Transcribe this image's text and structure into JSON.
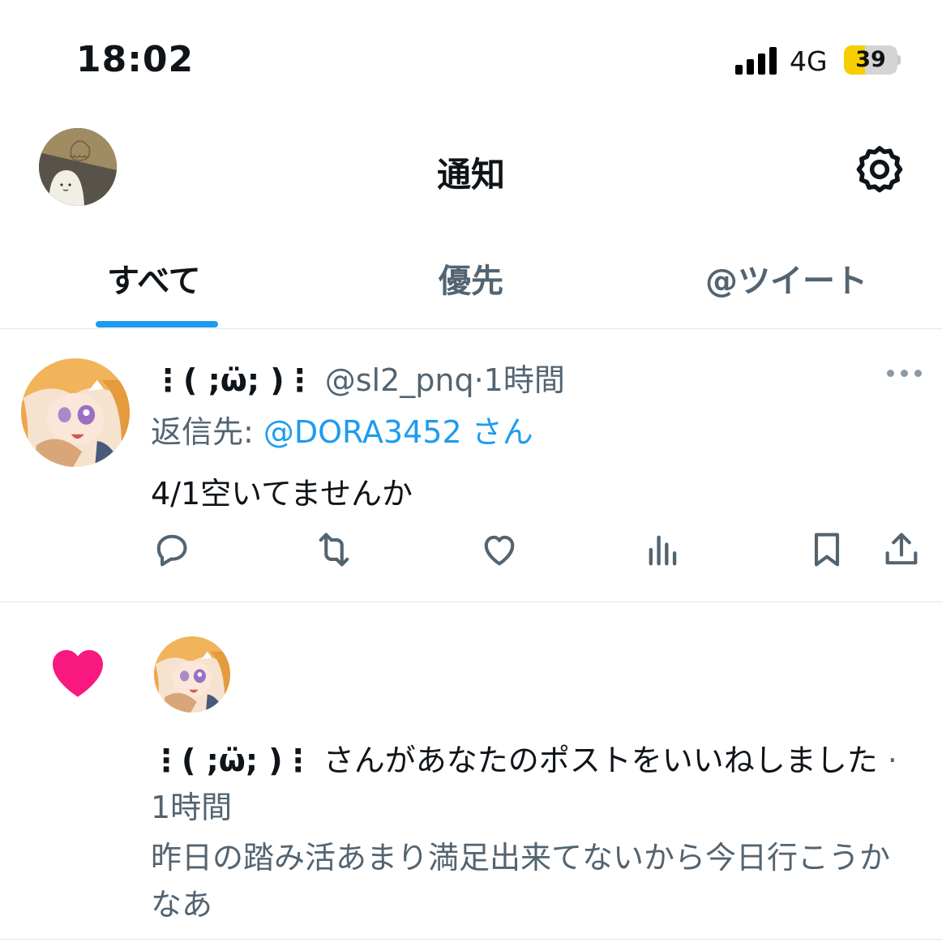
{
  "status_bar": {
    "time": "18:02",
    "network": "4G",
    "battery_percent": "39",
    "battery_level": 0.39,
    "battery_color": "#f7ce00"
  },
  "header": {
    "title": "通知",
    "profile_avatar_icon": "profile-avatar",
    "settings_icon": "gear-icon"
  },
  "tabs": [
    {
      "label": "すべて",
      "active": true
    },
    {
      "label": "優先",
      "active": false
    },
    {
      "label": "@ツイート",
      "active": false
    }
  ],
  "accent_color": "#1d9bf0",
  "reply_tweet": {
    "display_name": "⋮( ;ω̈; )⋮",
    "handle": "@sl2_pnq",
    "separator": "·",
    "time_ago": "1時間",
    "reply_label": "返信先: ",
    "reply_to": "@DORA3452 さん",
    "text": "4/1空いてませんか",
    "actions": [
      "reply-icon",
      "retweet-icon",
      "like-icon",
      "views-icon",
      "bookmark-icon",
      "share-icon"
    ]
  },
  "like_notification": {
    "icon": "heart-icon",
    "icon_color": "#f91880",
    "actor_name": "⋮( ;ω̈; )⋮",
    "message": " さんがあなたのポストをいいねしました",
    "separator": " · ",
    "time_ago": "1時間",
    "post_preview": "昨日の踏み活あまり満足出来てないから今日行こうかなあ"
  }
}
